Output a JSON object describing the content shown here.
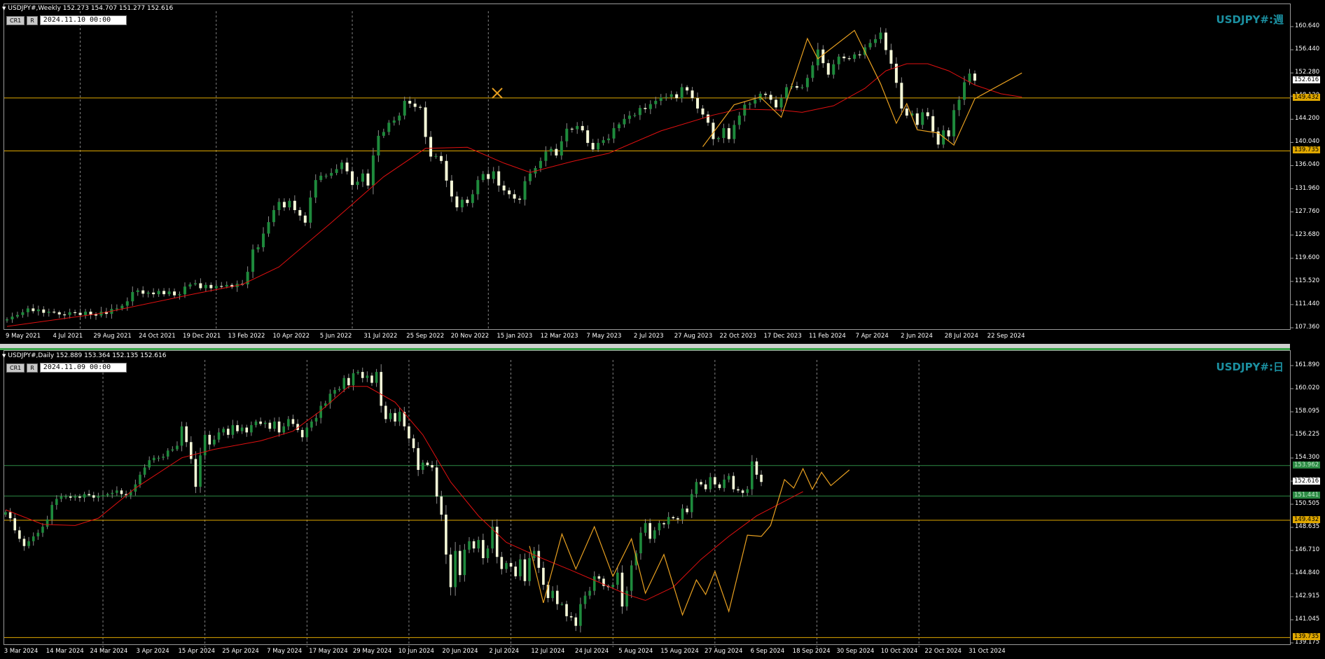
{
  "colors": {
    "background": "#000000",
    "bull_body": "#1e8a3c",
    "bear_body": "#f5f9d8",
    "wick": "#8a8a8a",
    "ma": "#e01010",
    "zigzag": "#e8a020",
    "hline_gold": "#e0a800",
    "hline_green": "#2c8a44",
    "grid": "#c8c8c8",
    "watermark": "#1b8fa0"
  },
  "chart_data": [
    {
      "type": "candlestick",
      "title": "USDJPY#,Weekly  152.273 154.707 151.277 152.616",
      "controls": {
        "cr_label": "CR1",
        "r_label": "R",
        "datetime": "2024.11.10 00:00"
      },
      "watermark": "USDJPY#:週",
      "ylim": [
        107.36,
        164.8
      ],
      "y_ticks": [
        "160.640",
        "156.440",
        "152.280",
        "148.120",
        "144.200",
        "140.040",
        "136.040",
        "131.960",
        "127.760",
        "123.680",
        "119.600",
        "115.520",
        "111.440",
        "107.360"
      ],
      "x_ticks": [
        "9 May 2021",
        "4 Jul 2021",
        "29 Aug 2021",
        "24 Oct 2021",
        "19 Dec 2021",
        "13 Feb 2022",
        "10 Apr 2022",
        "5 Jun 2022",
        "31 Jul 2022",
        "25 Sep 2022",
        "20 Nov 2022",
        "15 Jan 2023",
        "12 Mar 2023",
        "7 May 2023",
        "2 Jul 2023",
        "27 Aug 2023",
        "22 Oct 2023",
        "17 Dec 2023",
        "11 Feb 2024",
        "7 Apr 2024",
        "2 Jun 2024",
        "28 Jul 2024",
        "22 Sep 2024"
      ],
      "price_labels": [
        {
          "text": "152.616",
          "value": 152.616,
          "style": "current"
        },
        {
          "text": "149.432",
          "value": 149.432,
          "style": "gold"
        },
        {
          "text": "139.735",
          "value": 139.735,
          "style": "gold"
        }
      ],
      "hlines": [
        {
          "value": 149.432,
          "color": "gold"
        },
        {
          "value": 139.735,
          "color": "gold"
        }
      ],
      "vgrid_x_index": [
        14,
        40,
        66,
        92
      ],
      "close": [
        108.9,
        109.4,
        109.7,
        110.2,
        110.9,
        110.4,
        110.7,
        110.1,
        110.3,
        110.2,
        109.8,
        109.7,
        110.2,
        110.1,
        109.7,
        110.3,
        109.8,
        109.6,
        110.3,
        109.9,
        110.8,
        110.9,
        111.4,
        112.2,
        113.9,
        114.2,
        113.6,
        113.8,
        113.5,
        114.1,
        113.5,
        114.0,
        113.3,
        113.5,
        114.9,
        115.3,
        115.5,
        114.6,
        115.2,
        114.6,
        115.0,
        114.9,
        115.2,
        114.8,
        115.4,
        115.3,
        117.6,
        121.7,
        122.1,
        124.6,
        126.7,
        128.9,
        130.4,
        129.4,
        130.6,
        128.9,
        127.9,
        126.6,
        131.2,
        134.4,
        135.2,
        135.2,
        135.7,
        136.4,
        137.6,
        136.0,
        133.5,
        134.1,
        135.6,
        133.4,
        138.9,
        142.5,
        143.2,
        144.9,
        145.3,
        146.2,
        148.9,
        148.4,
        147.8,
        147.7,
        142.3,
        138.7,
        138.8,
        137.9,
        134.3,
        131.4,
        129.4,
        130.8,
        130.2,
        131.8,
        134.4,
        135.5,
        134.6,
        136.0,
        133.4,
        132.5,
        131.8,
        131.0,
        130.8,
        134.2,
        135.6,
        136.6,
        137.9,
        139.6,
        140.1,
        138.9,
        141.5,
        143.8,
        143.7,
        144.3,
        143.5,
        141.2,
        140.0,
        141.2,
        141.7,
        142.0,
        143.9,
        144.6,
        145.6,
        146.2,
        146.3,
        147.6,
        147.4,
        148.3,
        148.9,
        149.5,
        149.6,
        150.1,
        149.4,
        151.4,
        150.8,
        149.4,
        147.5,
        146.4,
        144.9,
        141.9,
        142.1,
        143.9,
        141.9,
        144.5,
        146.2,
        148.2,
        148.4,
        149.1,
        150.2,
        150.0,
        149.1,
        147.7,
        149.4,
        151.4,
        151.6,
        151.3,
        151.4,
        153.1,
        155.4,
        158.3,
        155.8,
        153.7,
        155.6,
        157.0,
        156.7,
        156.6,
        157.4,
        157.3,
        158.7,
        159.5,
        160.2,
        161.4,
        158.2,
        155.7,
        152.2,
        147.5,
        146.2,
        146.6,
        144.5,
        146.8,
        146.1,
        143.3,
        140.9,
        143.5,
        142.4,
        147.2,
        149.1,
        152.3,
        153.9,
        152.6
      ],
      "ma_points": [
        [
          0,
          107.6
        ],
        [
          18,
          110.0
        ],
        [
          35,
          113.4
        ],
        [
          45,
          115.3
        ],
        [
          52,
          118.5
        ],
        [
          62,
          126.6
        ],
        [
          72,
          135.0
        ],
        [
          80,
          140.2
        ],
        [
          88,
          140.4
        ],
        [
          95,
          137.5
        ],
        [
          100,
          135.8
        ],
        [
          108,
          137.8
        ],
        [
          115,
          139.3
        ],
        [
          125,
          143.4
        ],
        [
          135,
          146.3
        ],
        [
          140,
          147.4
        ],
        [
          148,
          147.2
        ],
        [
          152,
          146.8
        ],
        [
          158,
          148.0
        ],
        [
          164,
          151.2
        ],
        [
          168,
          154.4
        ],
        [
          172,
          155.7
        ],
        [
          176,
          155.7
        ],
        [
          180,
          154.4
        ],
        [
          185,
          151.8
        ],
        [
          190,
          150.2
        ],
        [
          194,
          149.6
        ]
      ],
      "zigzag_points": [
        [
          133,
          140.5
        ],
        [
          139,
          148.2
        ],
        [
          144,
          149.6
        ],
        [
          148,
          145.9
        ],
        [
          153,
          160.3
        ],
        [
          155,
          156.6
        ],
        [
          162,
          161.8
        ],
        [
          167,
          152.0
        ],
        [
          170,
          144.8
        ],
        [
          172,
          148.4
        ],
        [
          174,
          143.6
        ],
        [
          178,
          143.0
        ],
        [
          181,
          140.8
        ],
        [
          185,
          149.3
        ],
        [
          194,
          154.0
        ]
      ]
    },
    {
      "type": "candlestick",
      "title": "USDJPY#,Daily  152.889 153.364 152.135 152.616",
      "controls": {
        "cr_label": "CR1",
        "r_label": "R",
        "datetime": "2024.11.09 00:00"
      },
      "watermark": "USDJPY#:日",
      "ylim": [
        139.175,
        162.46
      ],
      "y_ticks": [
        "161.890",
        "160.020",
        "158.095",
        "156.225",
        "154.300",
        "152.616",
        "150.505",
        "148.635",
        "146.710",
        "144.840",
        "142.915",
        "141.045",
        "139.175"
      ],
      "x_ticks": [
        "3 Mar 2024",
        "14 Mar 2024",
        "24 Mar 2024",
        "3 Apr 2024",
        "15 Apr 2024",
        "25 Apr 2024",
        "7 May 2024",
        "17 May 2024",
        "29 May 2024",
        "10 Jun 2024",
        "20 Jun 2024",
        "2 Jul 2024",
        "12 Jul 2024",
        "24 Jul 2024",
        "5 Aug 2024",
        "15 Aug 2024",
        "27 Aug 2024",
        "6 Sep 2024",
        "18 Sep 2024",
        "30 Sep 2024",
        "10 Oct 2024",
        "22 Oct 2024",
        "31 Oct 2024"
      ],
      "price_labels": [
        {
          "text": "153.962",
          "value": 153.962,
          "style": "green"
        },
        {
          "text": "152.616",
          "value": 152.616,
          "style": "current"
        },
        {
          "text": "151.441",
          "value": 151.441,
          "style": "green"
        },
        {
          "text": "149.432",
          "value": 149.432,
          "style": "gold"
        },
        {
          "text": "139.735",
          "value": 139.735,
          "style": "gold"
        }
      ],
      "hlines": [
        {
          "value": 153.962,
          "color": "green"
        },
        {
          "value": 151.441,
          "color": "green"
        },
        {
          "value": 149.432,
          "color": "gold"
        },
        {
          "value": 139.735,
          "color": "gold"
        }
      ],
      "vgrid_x_index": [
        21,
        43,
        65,
        87,
        109,
        131,
        153,
        175,
        197
      ],
      "close": [
        150.1,
        149.6,
        148.6,
        147.9,
        147.3,
        147.7,
        148.1,
        148.4,
        148.9,
        149.5,
        150.7,
        151.2,
        151.4,
        151.4,
        151.3,
        151.4,
        151.3,
        151.6,
        151.5,
        151.3,
        151.4,
        151.5,
        151.6,
        151.7,
        151.9,
        151.6,
        151.5,
        151.8,
        152.4,
        153.2,
        153.8,
        154.4,
        154.6,
        154.6,
        154.7,
        155.2,
        155.3,
        155.6,
        157.2,
        155.9,
        154.5,
        152.2,
        154.8,
        156.5,
        155.7,
        156.1,
        156.7,
        157.0,
        156.5,
        157.3,
        156.8,
        157.1,
        156.7,
        157.3,
        157.6,
        157.4,
        157.5,
        157.0,
        157.6,
        156.7,
        157.2,
        157.8,
        157.4,
        156.9,
        156.3,
        157.1,
        157.6,
        157.9,
        158.9,
        159.1,
        159.9,
        160.2,
        160.3,
        161.2,
        160.6,
        161.6,
        161.7,
        161.2,
        161.4,
        160.8,
        161.7,
        158.9,
        157.8,
        158.3,
        157.6,
        158.4,
        157.2,
        156.2,
        155.4,
        153.6,
        154.2,
        154.0,
        153.8,
        151.4,
        149.9,
        146.6,
        143.9,
        146.9,
        144.9,
        147.0,
        147.7,
        147.1,
        147.8,
        146.3,
        147.1,
        148.9,
        146.4,
        145.4,
        145.9,
        145.6,
        144.8,
        146.2,
        144.4,
        146.3,
        146.9,
        145.5,
        144.1,
        143.0,
        143.6,
        142.5,
        142.5,
        141.5,
        141.4,
        140.7,
        142.5,
        143.2,
        143.6,
        144.8,
        144.6,
        144.0,
        143.9,
        144.1,
        145.1,
        142.3,
        143.6,
        145.7,
        146.7,
        148.4,
        149.2,
        147.9,
        148.6,
        149.2,
        149.1,
        149.7,
        149.6,
        149.5,
        150.4,
        150.1,
        151.6,
        152.6,
        152.4,
        152.0,
        153.0,
        152.4,
        152.1,
        152.8,
        153.1,
        152.0,
        151.9,
        151.7,
        152.0,
        154.3,
        153.2,
        152.6
      ],
      "ma_points": [
        [
          0,
          150.3
        ],
        [
          8,
          149.1
        ],
        [
          15,
          149.0
        ],
        [
          20,
          149.6
        ],
        [
          28,
          152.1
        ],
        [
          38,
          154.6
        ],
        [
          45,
          155.3
        ],
        [
          55,
          156.0
        ],
        [
          62,
          156.8
        ],
        [
          68,
          158.5
        ],
        [
          74,
          160.5
        ],
        [
          78,
          160.5
        ],
        [
          84,
          159.2
        ],
        [
          90,
          156.5
        ],
        [
          96,
          152.6
        ],
        [
          102,
          149.8
        ],
        [
          108,
          147.6
        ],
        [
          115,
          146.4
        ],
        [
          122,
          145.3
        ],
        [
          128,
          144.3
        ],
        [
          134,
          143.3
        ],
        [
          138,
          142.8
        ],
        [
          144,
          143.9
        ],
        [
          150,
          146.2
        ],
        [
          156,
          148.1
        ],
        [
          162,
          149.8
        ],
        [
          167,
          150.8
        ],
        [
          172,
          151.8
        ]
      ],
      "zigzag_points": [
        [
          113,
          147.3
        ],
        [
          116,
          142.6
        ],
        [
          120,
          148.3
        ],
        [
          123,
          145.4
        ],
        [
          127,
          148.9
        ],
        [
          131,
          144.8
        ],
        [
          135,
          147.9
        ],
        [
          138,
          143.4
        ],
        [
          142,
          146.6
        ],
        [
          146,
          141.6
        ],
        [
          149,
          144.5
        ],
        [
          151,
          143.3
        ],
        [
          153,
          145.2
        ],
        [
          156,
          141.9
        ],
        [
          160,
          148.2
        ],
        [
          163,
          148.1
        ],
        [
          165,
          149.0
        ],
        [
          168,
          152.8
        ],
        [
          170,
          152.1
        ],
        [
          172,
          153.7
        ],
        [
          174,
          152.0
        ],
        [
          176,
          153.4
        ],
        [
          178,
          152.3
        ],
        [
          182,
          153.6
        ]
      ]
    }
  ]
}
